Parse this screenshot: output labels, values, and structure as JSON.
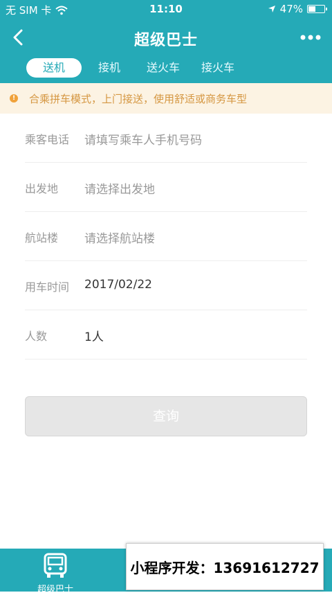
{
  "status_bar": {
    "carrier": "无 SIM 卡",
    "time": "11:10",
    "battery_percent_text": "47%",
    "battery_level": 0.47,
    "icons": [
      "wifi-icon",
      "location-arrow-icon",
      "battery-icon"
    ]
  },
  "header": {
    "title": "超级巴士",
    "icons": [
      "back-chevron-icon",
      "more-dots-icon"
    ]
  },
  "tabs": [
    {
      "label": "送机",
      "active": true
    },
    {
      "label": "接机",
      "active": false
    },
    {
      "label": "送火车",
      "active": false
    },
    {
      "label": "接火车",
      "active": false
    }
  ],
  "notice": {
    "text": "合乘拼车模式，上门接送，使用舒适或商务车型",
    "icon": "info-icon"
  },
  "form": {
    "rows": [
      {
        "label": "乘客电话",
        "value": "请填写乘车人手机号码",
        "placeholder": true
      },
      {
        "label": "出发地",
        "value": "请选择出发地",
        "placeholder": true
      },
      {
        "label": "航站楼",
        "value": "请选择航站楼",
        "placeholder": true
      },
      {
        "label": "用车时间",
        "value": "2017/02/22",
        "placeholder": false
      },
      {
        "label": "人数",
        "value": "1人",
        "placeholder": false
      }
    ]
  },
  "query_button": {
    "label": "查询"
  },
  "bottom_nav": {
    "item_label": "超级巴士",
    "icon": "bus-icon"
  },
  "ad_overlay": {
    "text": "小程序开发：13691612727"
  },
  "colors": {
    "primary": "#25aab7",
    "notice_bg": "#fcf3e3",
    "notice_text": "#d59742",
    "button_disabled": "#e6e6e6"
  }
}
